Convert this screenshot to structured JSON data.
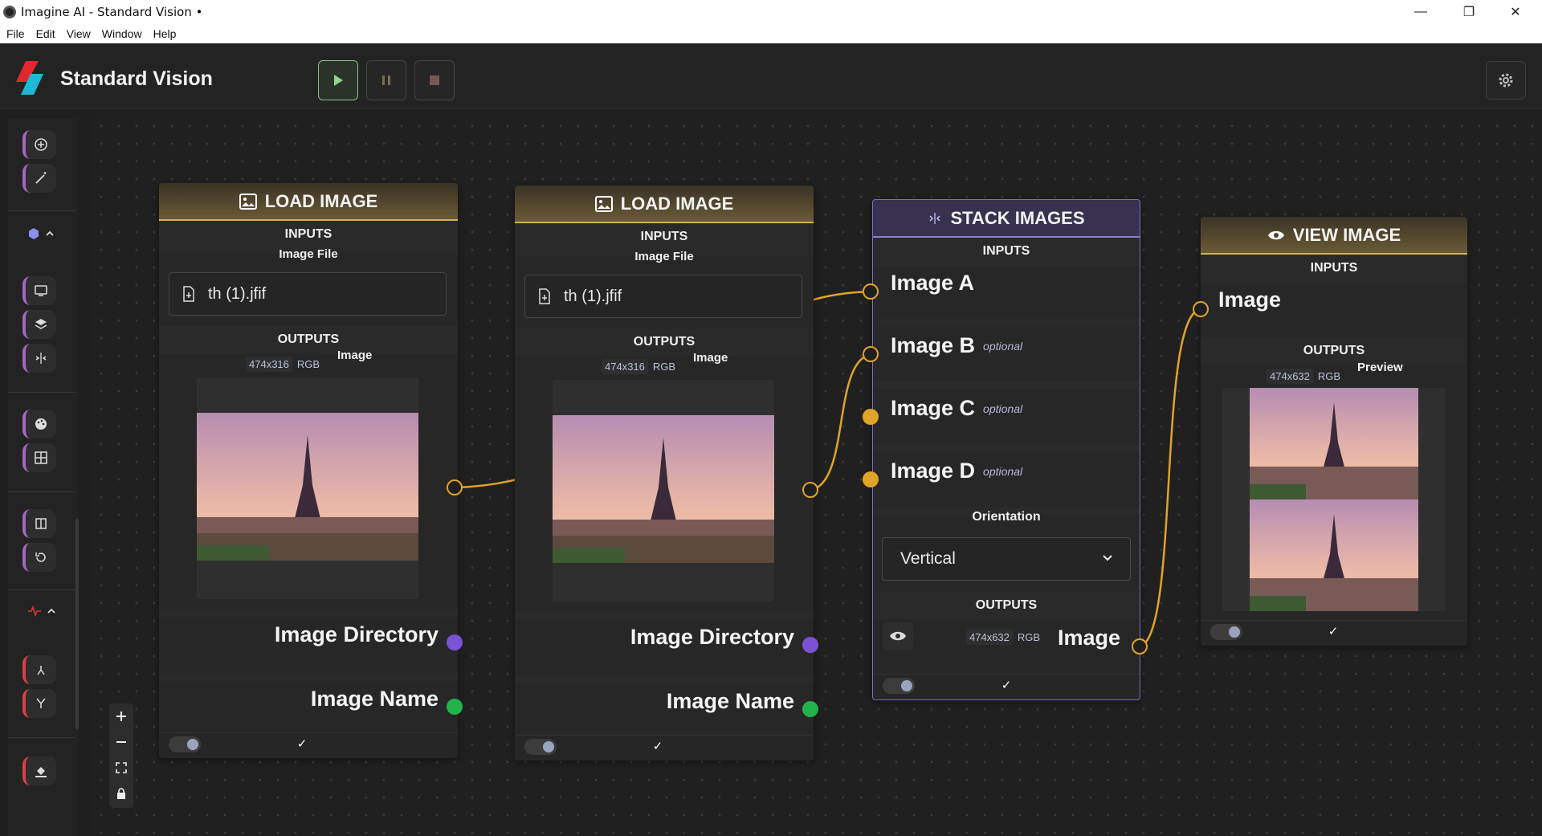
{
  "window": {
    "title": "Imagine AI - Standard Vision •",
    "menu": [
      "File",
      "Edit",
      "View",
      "Window",
      "Help"
    ]
  },
  "header": {
    "brand": "Standard Vision"
  },
  "sidebar": {
    "icons": [
      "add-circle-icon",
      "magic-wand-icon",
      "hexagon-icon",
      "monitor-icon",
      "layers-icon",
      "split-icon",
      "palette-icon",
      "grid-icon",
      "compare-icon",
      "rotate-icon",
      "pulse-icon",
      "merge-icon",
      "fork-icon",
      "paint-bucket-icon"
    ]
  },
  "nodes": {
    "load1": {
      "title": "LOAD IMAGE",
      "inputs_label": "INPUTS",
      "input_name": "Image File",
      "file_value": "th (1).jfif",
      "outputs_label": "OUTPUTS",
      "output_name": "Image",
      "dims": "474x316",
      "mode": "RGB",
      "dir_label": "Image Directory",
      "name_label": "Image Name"
    },
    "load2": {
      "title": "LOAD IMAGE",
      "inputs_label": "INPUTS",
      "input_name": "Image File",
      "file_value": "th (1).jfif",
      "outputs_label": "OUTPUTS",
      "output_name": "Image",
      "dims": "474x316",
      "mode": "RGB",
      "dir_label": "Image Directory",
      "name_label": "Image Name"
    },
    "stack": {
      "title": "STACK IMAGES",
      "inputs_label": "INPUTS",
      "input_a": "Image A",
      "input_b": "Image B",
      "input_c": "Image C",
      "input_d": "Image D",
      "optional": "optional",
      "orientation_label": "Orientation",
      "orientation_value": "Vertical",
      "outputs_label": "OUTPUTS",
      "dims": "474x632",
      "mode": "RGB",
      "output_name": "Image"
    },
    "view": {
      "title": "VIEW IMAGE",
      "inputs_label": "INPUTS",
      "input_name": "Image",
      "outputs_label": "OUTPUTS",
      "output_name": "Preview",
      "dims": "474x632",
      "mode": "RGB"
    }
  },
  "colors": {
    "gold_accent": "#d4b05a",
    "purple_accent": "#8f7fd0",
    "wire": "#e0a429",
    "handle_directory": "#7b52d4",
    "handle_name": "#21b34a"
  }
}
